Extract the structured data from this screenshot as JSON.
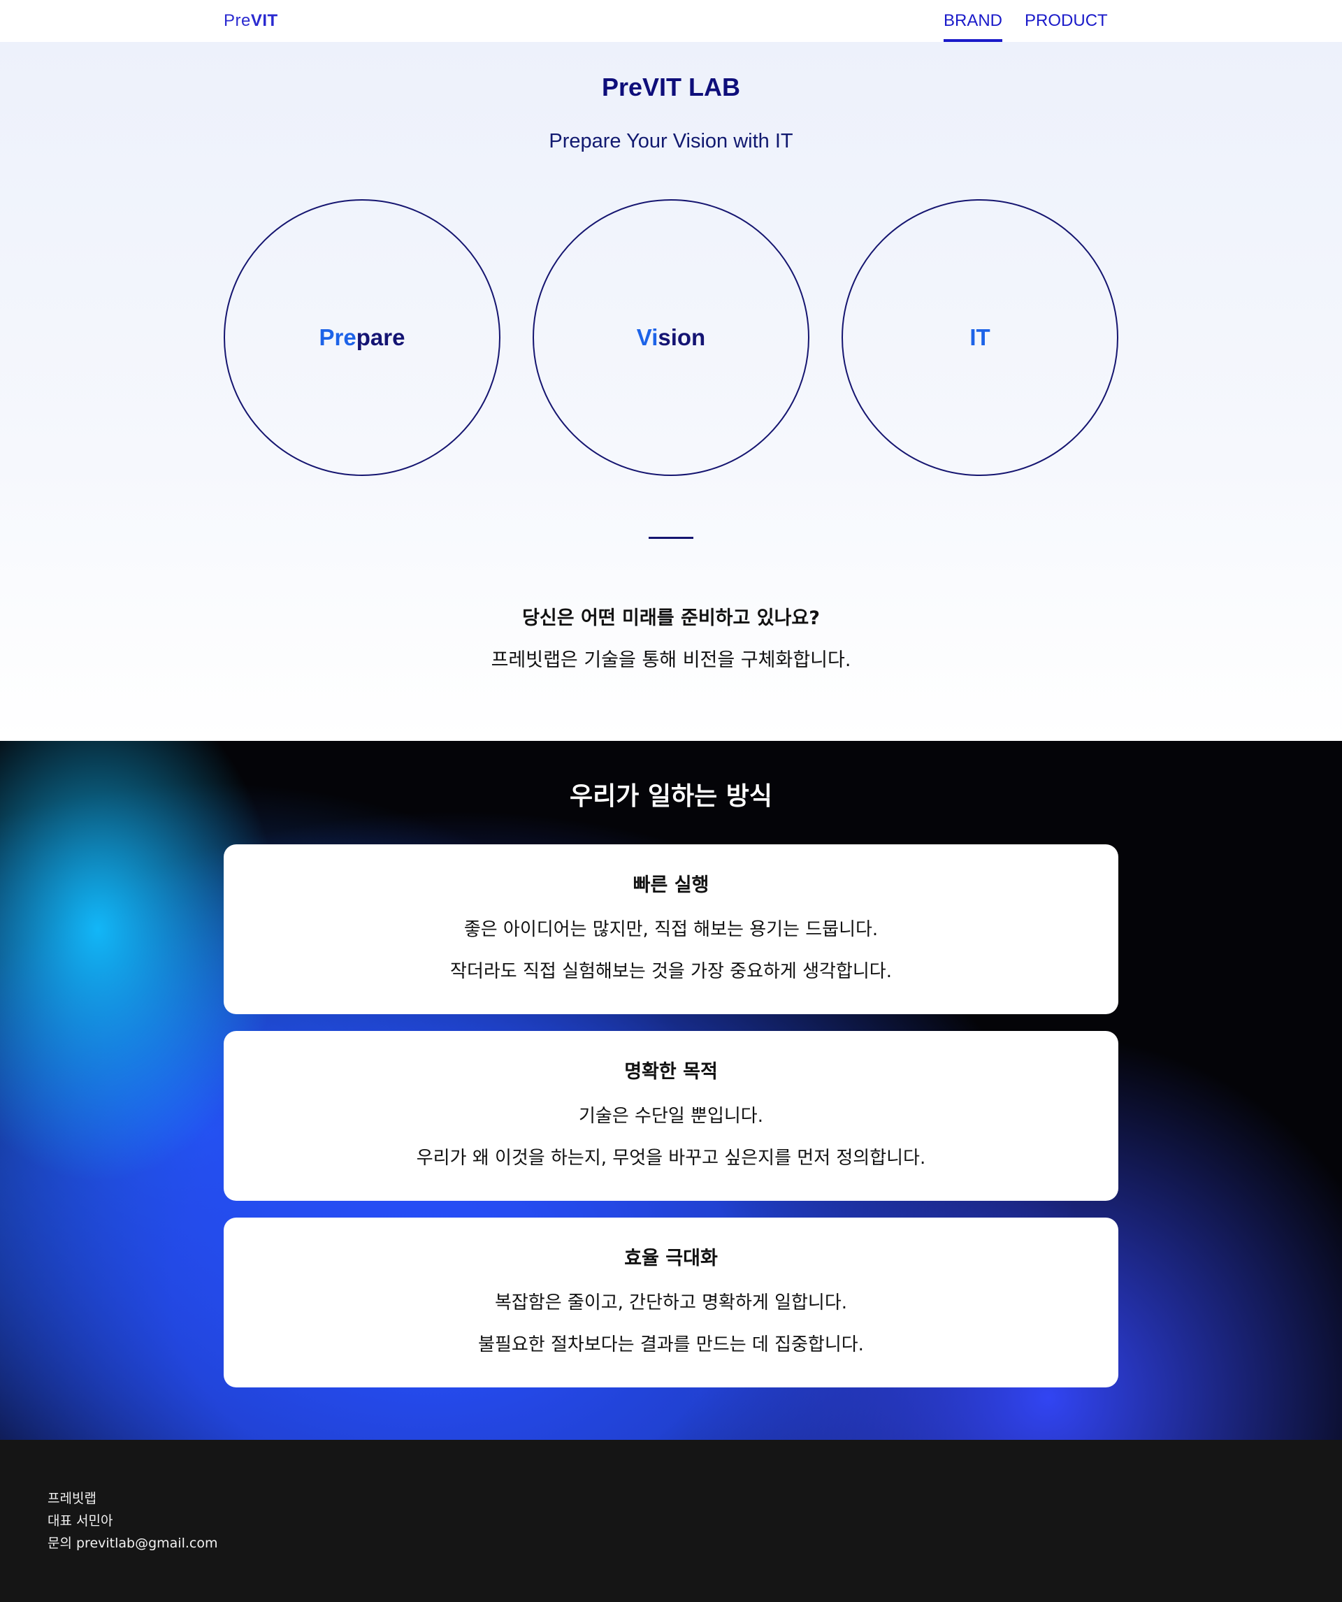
{
  "header": {
    "logo_pre": "Pre",
    "logo_vit": "VIT",
    "nav": [
      {
        "label": "BRAND",
        "active": true
      },
      {
        "label": "PRODUCT",
        "active": false
      }
    ]
  },
  "hero": {
    "title": "PreVIT LAB",
    "subtitle": "Prepare Your Vision with IT",
    "circles": [
      {
        "highlight": "Pre",
        "rest": "pare"
      },
      {
        "highlight": "Vi",
        "rest": "sion"
      },
      {
        "highlight": "IT",
        "rest": ""
      }
    ],
    "question": "당신은 어떤 미래를 준비하고 있나요?",
    "answer": "프레빗랩은 기술을 통해 비전을 구체화합니다."
  },
  "how": {
    "title": "우리가 일하는 방식",
    "cards": [
      {
        "title": "빠른 실행",
        "line1": "좋은 아이디어는 많지만, 직접 해보는 용기는 드뭅니다.",
        "line2": "작더라도 직접 실험해보는 것을 가장 중요하게 생각합니다."
      },
      {
        "title": "명확한 목적",
        "line1": "기술은 수단일 뿐입니다.",
        "line2": "우리가 왜 이것을 하는지, 무엇을 바꾸고 싶은지를 먼저 정의합니다."
      },
      {
        "title": "효율 극대화",
        "line1": "복잡함은 줄이고, 간단하고 명확하게 일합니다.",
        "line2": "불필요한 절차보다는 결과를 만드는 데 집중합니다."
      }
    ]
  },
  "footer": {
    "company": "프레빗랩",
    "ceo": "대표 서민아",
    "contact": "문의 previtlab@gmail.com"
  },
  "colors": {
    "brand": "#1a1ac9",
    "navy": "#141473",
    "highlight_blue": "#1d63e8",
    "footer_bg": "#151515"
  }
}
